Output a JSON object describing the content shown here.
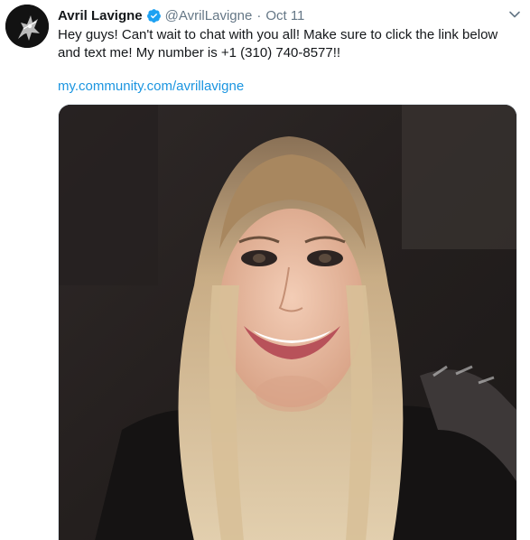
{
  "tweet": {
    "display_name": "Avril Lavigne",
    "handle": "@AvrilLavigne",
    "separator": "·",
    "date": "Oct 11",
    "text": "Hey guys! Can't wait to chat with you all! Make sure to click the link below and text me! My number is +1 (310) 740-8577!!",
    "link": "my.community.com/avrillavigne"
  },
  "colors": {
    "link": "#1b95e0",
    "verified": "#1da1f2",
    "secondary_text": "#657786",
    "primary_text": "#14171a"
  },
  "icons": {
    "verified": "verified-badge-icon",
    "menu": "chevron-down-icon"
  }
}
